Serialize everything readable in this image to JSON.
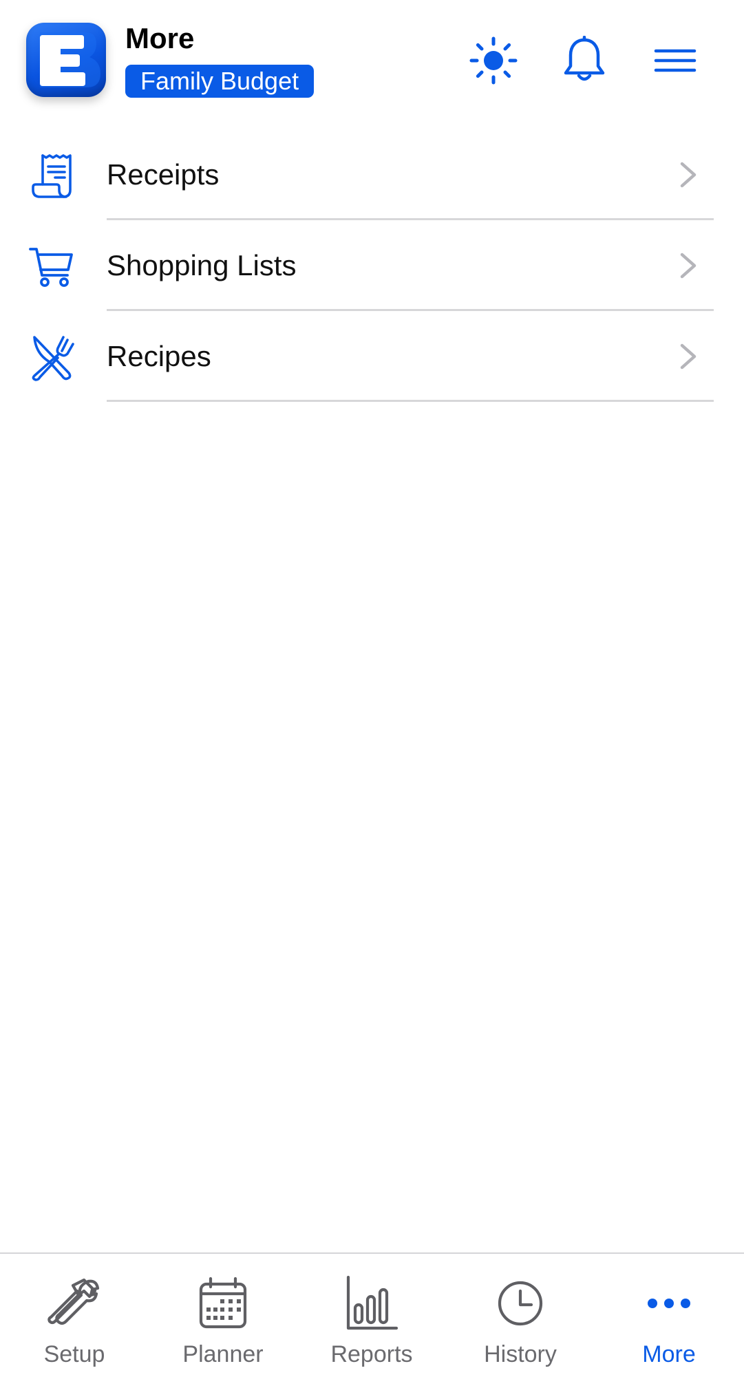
{
  "header": {
    "title": "More",
    "budget_badge": "Family Budget",
    "icons": [
      "sun-icon",
      "bell-icon",
      "hamburger-menu-icon"
    ]
  },
  "menu": {
    "items": [
      {
        "label": "Receipts",
        "icon": "receipt-icon"
      },
      {
        "label": "Shopping Lists",
        "icon": "shopping-cart-icon"
      },
      {
        "label": "Recipes",
        "icon": "utensils-icon"
      }
    ]
  },
  "tabs": [
    {
      "label": "Setup",
      "icon": "tools-icon",
      "active": false
    },
    {
      "label": "Planner",
      "icon": "calendar-icon",
      "active": false
    },
    {
      "label": "Reports",
      "icon": "bar-chart-icon",
      "active": false
    },
    {
      "label": "History",
      "icon": "clock-icon",
      "active": false
    },
    {
      "label": "More",
      "icon": "ellipsis-icon",
      "active": true
    }
  ],
  "colors": {
    "accent": "#0a5be6",
    "tab_inactive": "#6a6a6e",
    "divider": "#d7d7d9",
    "chevron": "#b5b5ba"
  }
}
